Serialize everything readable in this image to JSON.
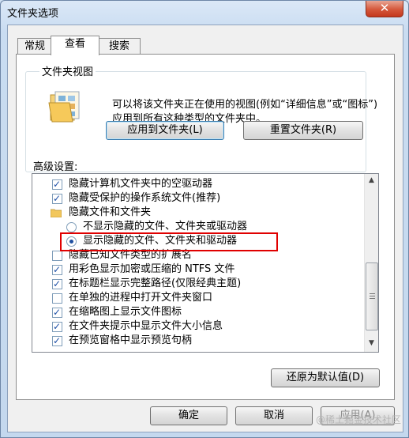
{
  "window": {
    "title": "文件夹选项",
    "close_glyph": "✕"
  },
  "tabs": [
    {
      "label": "常规"
    },
    {
      "label": "查看"
    },
    {
      "label": "搜索"
    }
  ],
  "folder_views": {
    "group_label": "文件夹视图",
    "description": "可以将该文件夹正在使用的视图(例如“详细信息”或“图标”)应用到所有这种类型的文件夹中。",
    "apply_button": "应用到文件夹(L)",
    "reset_button": "重置文件夹(R)"
  },
  "advanced": {
    "label": "高级设置:",
    "items": [
      {
        "kind": "checkbox",
        "checked": true,
        "label": "隐藏计算机文件夹中的空驱动器"
      },
      {
        "kind": "checkbox",
        "checked": true,
        "label": "隐藏受保护的操作系统文件(推荐)"
      },
      {
        "kind": "folder",
        "label": "隐藏文件和文件夹"
      },
      {
        "kind": "radio",
        "checked": false,
        "label": "不显示隐藏的文件、文件夹或驱动器"
      },
      {
        "kind": "radio",
        "checked": true,
        "label": "显示隐藏的文件、文件夹和驱动器"
      },
      {
        "kind": "checkbox",
        "checked": false,
        "label": "隐藏已知文件类型的扩展名"
      },
      {
        "kind": "checkbox",
        "checked": true,
        "label": "用彩色显示加密或压缩的 NTFS 文件"
      },
      {
        "kind": "checkbox",
        "checked": true,
        "label": "在标题栏显示完整路径(仅限经典主题)"
      },
      {
        "kind": "checkbox",
        "checked": false,
        "label": "在单独的进程中打开文件夹窗口"
      },
      {
        "kind": "checkbox",
        "checked": true,
        "label": "在缩略图上显示文件图标"
      },
      {
        "kind": "checkbox",
        "checked": true,
        "label": "在文件夹提示中显示文件大小信息"
      },
      {
        "kind": "checkbox",
        "checked": true,
        "label": "在预览窗格中显示预览句柄"
      }
    ],
    "restore_button": "还原为默认值(D)"
  },
  "footer": {
    "ok": "确定",
    "cancel": "取消",
    "apply": "应用(A)"
  },
  "watermark": "@稀土掘金技术社区"
}
